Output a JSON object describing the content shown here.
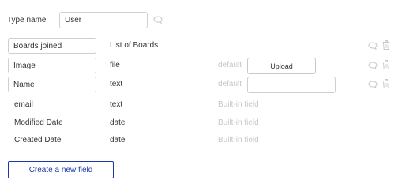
{
  "type_name_label": "Type name",
  "type_name_value": "User",
  "fields": [
    {
      "name": "Boards joined",
      "type": "List of Boards",
      "editable": true
    },
    {
      "name": "Image",
      "type": "file",
      "editable": true,
      "default_label": "default",
      "upload_label": "Upload"
    },
    {
      "name": "Name",
      "type": "text",
      "editable": true,
      "default_label": "default",
      "default_value": ""
    }
  ],
  "builtin_fields": [
    {
      "name": "email",
      "type": "text",
      "note": "Built-in field"
    },
    {
      "name": "Modified Date",
      "type": "date",
      "note": "Built-in field"
    },
    {
      "name": "Created Date",
      "type": "date",
      "note": "Built-in field"
    }
  ],
  "create_button_label": "Create a new field",
  "icons": {
    "comment": "comment-bubble-icon",
    "trash": "trash-icon"
  },
  "colors": {
    "primary": "#1b3aa8",
    "border": "#cfcfcf",
    "muted": "#c8c8c8"
  }
}
